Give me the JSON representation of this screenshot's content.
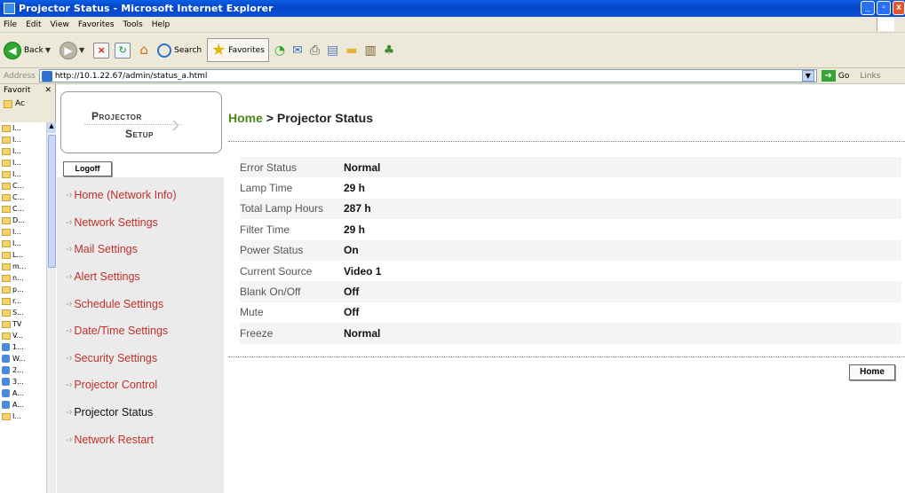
{
  "window": {
    "title": "Projector Status - Microsoft Internet Explorer",
    "controls": [
      "_",
      "▫",
      "x"
    ]
  },
  "menu": [
    "File",
    "Edit",
    "View",
    "Favorites",
    "Tools",
    "Help"
  ],
  "toolbar": {
    "back_label": "Back",
    "search_label": "Search",
    "favorites_label": "Favorites"
  },
  "address": {
    "label": "Address",
    "url": "http://10.1.22.67/admin/status_a.html",
    "go_label": "Go",
    "links_label": "Links"
  },
  "favorites_pane": {
    "title": "Favorit",
    "subtitle": "Ac",
    "items": [
      {
        "type": "folder",
        "label": "I..."
      },
      {
        "type": "folder",
        "label": "I..."
      },
      {
        "type": "folder",
        "label": "I..."
      },
      {
        "type": "folder",
        "label": "I..."
      },
      {
        "type": "folder",
        "label": "I..."
      },
      {
        "type": "folder",
        "label": "C..."
      },
      {
        "type": "folder",
        "label": "C..."
      },
      {
        "type": "folder",
        "label": "C..."
      },
      {
        "type": "folder",
        "label": "D..."
      },
      {
        "type": "folder",
        "label": "I..."
      },
      {
        "type": "folder",
        "label": "I..."
      },
      {
        "type": "folder",
        "label": "L..."
      },
      {
        "type": "folder",
        "label": "m..."
      },
      {
        "type": "folder",
        "label": "n..."
      },
      {
        "type": "folder",
        "label": "p..."
      },
      {
        "type": "folder",
        "label": "r..."
      },
      {
        "type": "folder",
        "label": "S..."
      },
      {
        "type": "folder",
        "label": "TV"
      },
      {
        "type": "folder",
        "label": "V..."
      },
      {
        "type": "page",
        "label": "1..."
      },
      {
        "type": "page",
        "label": "W..."
      },
      {
        "type": "page",
        "label": "2..."
      },
      {
        "type": "page",
        "label": "3..."
      },
      {
        "type": "page",
        "label": "A..."
      },
      {
        "type": "page",
        "label": "A..."
      },
      {
        "type": "folder",
        "label": "I..."
      }
    ]
  },
  "logo": {
    "line1": "Projector",
    "line2": "Setup"
  },
  "logoff_label": "Logoff",
  "nav": [
    {
      "label": "Home (Network Info)",
      "active": false
    },
    {
      "label": "Network Settings",
      "active": false
    },
    {
      "label": "Mail Settings",
      "active": false
    },
    {
      "label": "Alert Settings",
      "active": false
    },
    {
      "label": "Schedule Settings",
      "active": false
    },
    {
      "label": "Date/Time Settings",
      "active": false
    },
    {
      "label": "Security Settings",
      "active": false
    },
    {
      "label": "Projector Control",
      "active": false
    },
    {
      "label": "Projector Status",
      "active": true
    },
    {
      "label": "Network Restart",
      "active": false
    }
  ],
  "breadcrumb": {
    "home": "Home",
    "separator": " > ",
    "current": "Projector Status"
  },
  "status": [
    {
      "label": "Error Status",
      "value": "Normal"
    },
    {
      "label": "Lamp Time",
      "value": "29 h"
    },
    {
      "label": "Total Lamp Hours",
      "value": "287 h"
    },
    {
      "label": "Filter Time",
      "value": "29 h"
    },
    {
      "label": "Power Status",
      "value": "On"
    },
    {
      "label": "Current Source",
      "value": "Video 1"
    },
    {
      "label": "Blank On/Off",
      "value": "Off"
    },
    {
      "label": "Mute",
      "value": "Off"
    },
    {
      "label": "Freeze",
      "value": "Normal"
    }
  ],
  "home_button": "Home",
  "colors": {
    "nav_link": "#c0302a",
    "breadcrumb_home": "#4a8a1a",
    "titlebar": "#0546c9"
  }
}
